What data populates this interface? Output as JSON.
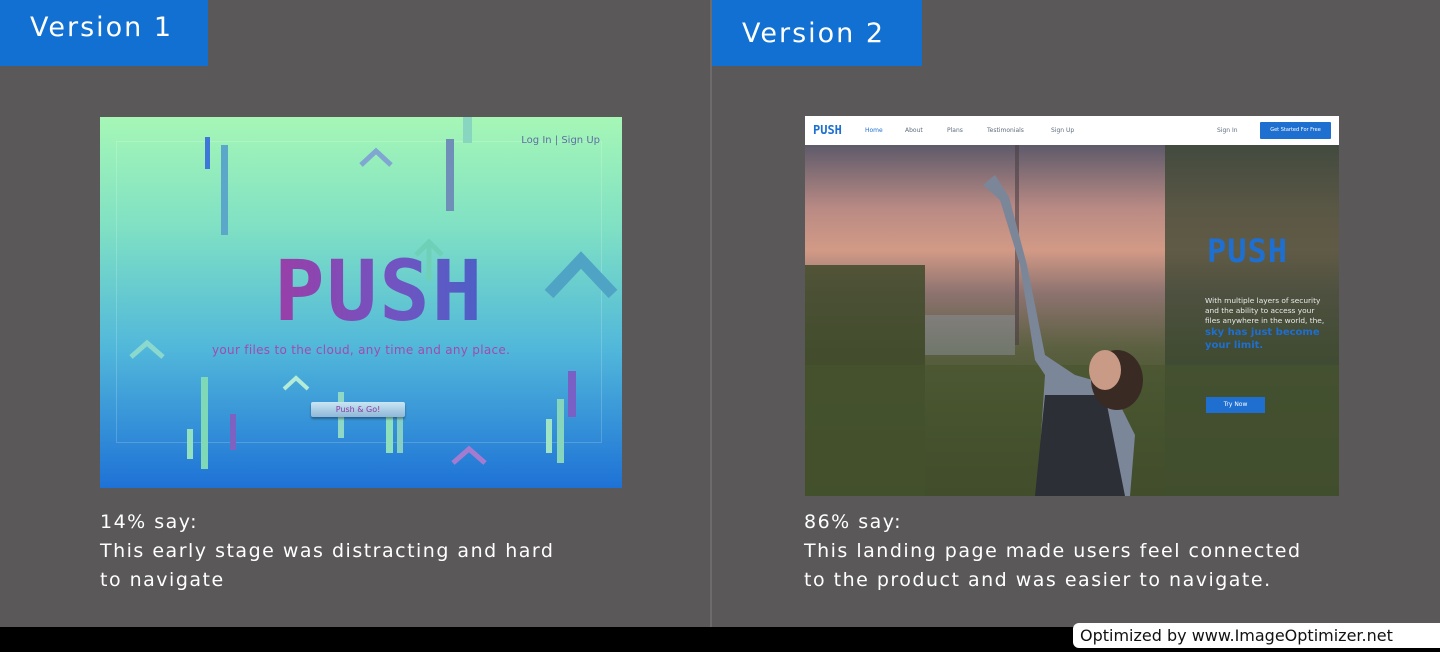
{
  "version1": {
    "label": "Version 1",
    "mock": {
      "login_links": "Log In | Sign Up",
      "logo": "PUSH",
      "tagline": "your files to the cloud, any time and any place.",
      "button": "Push & Go!"
    },
    "caption": {
      "stat": "14% say:",
      "line1": "This early stage was distracting and hard",
      "line2": "to navigate"
    }
  },
  "version2": {
    "label": "Version 2",
    "mock": {
      "logo": "PUSH",
      "nav_links": [
        "Home",
        "About",
        "Plans",
        "Testimonials",
        "Sign Up"
      ],
      "sign_in": "Sign In",
      "get_started": "Get Started For Free",
      "hero_logo": "PUSH",
      "body_text": "With multiple layers of security and the ability to access your files anywhere in the world, the,",
      "highlight": "sky has just become your limit.",
      "cta": "Try Now"
    },
    "caption": {
      "stat": "86% say:",
      "line1": "This landing page made users feel connected",
      "line2": "to the product and was easier to navigate."
    }
  },
  "watermark": "Optimized by www.ImageOptimizer.net",
  "colors": {
    "panel_bg": "#5a5859",
    "tag_blue": "#1170d2",
    "brand_blue": "#1e6fd0",
    "v1_purple": "#9a3ea8"
  }
}
